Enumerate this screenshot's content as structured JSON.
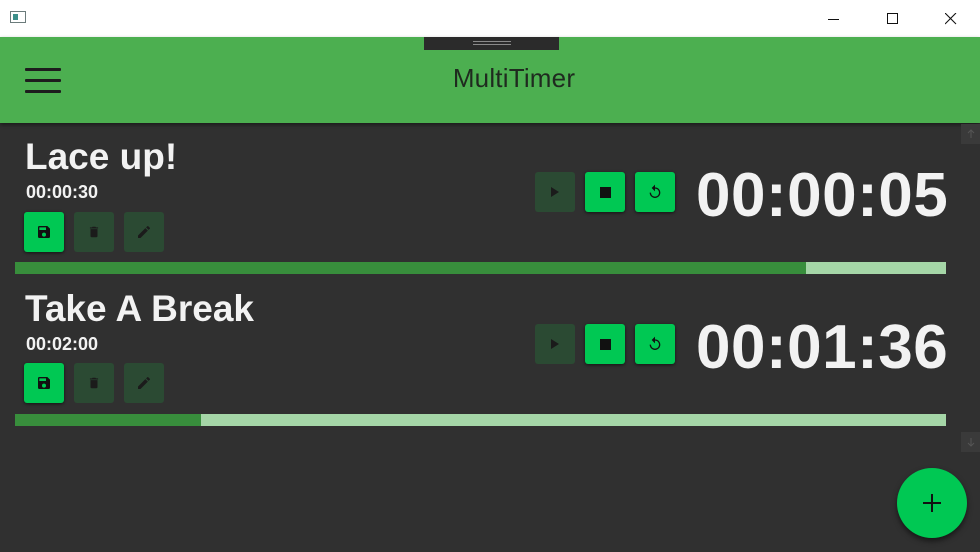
{
  "app": {
    "title": "MultiTimer",
    "accent_color": "#4caf50",
    "button_color": "#00c853"
  },
  "window_controls": [
    "minimize-icon",
    "maximize-icon",
    "close-icon"
  ],
  "timers": [
    {
      "name": "Lace up!",
      "duration": "00:00:30",
      "remaining": "00:00:05",
      "progress": 0.85,
      "icons": {
        "save": "save-icon",
        "delete": "trash-icon",
        "edit": "pencil-icon",
        "play": "play-icon",
        "stop": "stop-icon",
        "reset": "reset-icon"
      }
    },
    {
      "name": "Take A Break",
      "duration": "00:02:00",
      "remaining": "00:01:36",
      "progress": 0.2,
      "icons": {
        "save": "save-icon",
        "delete": "trash-icon",
        "edit": "pencil-icon",
        "play": "play-icon",
        "stop": "stop-icon",
        "reset": "reset-icon"
      }
    }
  ],
  "fab": {
    "icon": "plus-icon"
  }
}
